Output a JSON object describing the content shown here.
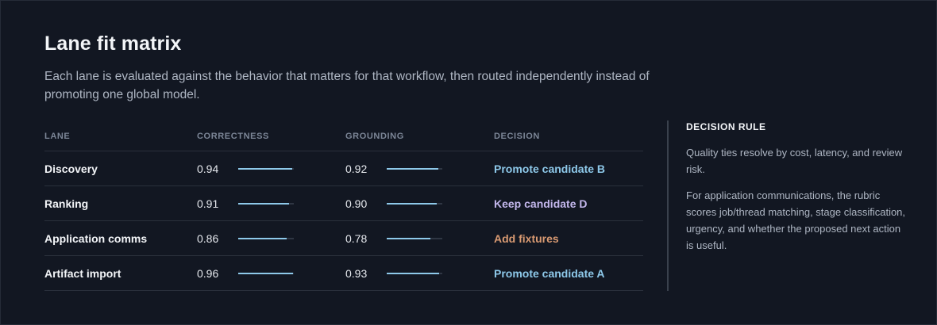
{
  "header": {
    "title": "Lane fit matrix",
    "subtitle": "Each lane is evaluated against the behavior that matters for that workflow, then routed independently instead of promoting one global model."
  },
  "table": {
    "columns": [
      "LANE",
      "CORRECTNESS",
      "GROUNDING",
      "DECISION"
    ],
    "rows": [
      {
        "lane": "Discovery",
        "correctness": "0.94",
        "correctness_fill": 0.97,
        "grounding": "0.92",
        "grounding_fill": 0.93,
        "decision": "Promote candidate B",
        "decision_color": "#8ec9ea"
      },
      {
        "lane": "Ranking",
        "correctness": "0.91",
        "correctness_fill": 0.91,
        "grounding": "0.90",
        "grounding_fill": 0.9,
        "decision": "Keep candidate D",
        "decision_color": "#c3b7ec"
      },
      {
        "lane": "Application comms",
        "correctness": "0.86",
        "correctness_fill": 0.87,
        "grounding": "0.78",
        "grounding_fill": 0.79,
        "decision": "Add fixtures",
        "decision_color": "#d99a72"
      },
      {
        "lane": "Artifact import",
        "correctness": "0.96",
        "correctness_fill": 0.98,
        "grounding": "0.93",
        "grounding_fill": 0.94,
        "decision": "Promote candidate A",
        "decision_color": "#8ec9ea"
      }
    ],
    "bar_color": "#8ec9ea"
  },
  "rule": {
    "heading": "DECISION RULE",
    "paragraphs": [
      "Quality ties resolve by cost, latency, and review risk.",
      "For application communications, the rubric scores job/thread matching, stage classification, urgency, and whether the proposed next action is useful."
    ]
  }
}
